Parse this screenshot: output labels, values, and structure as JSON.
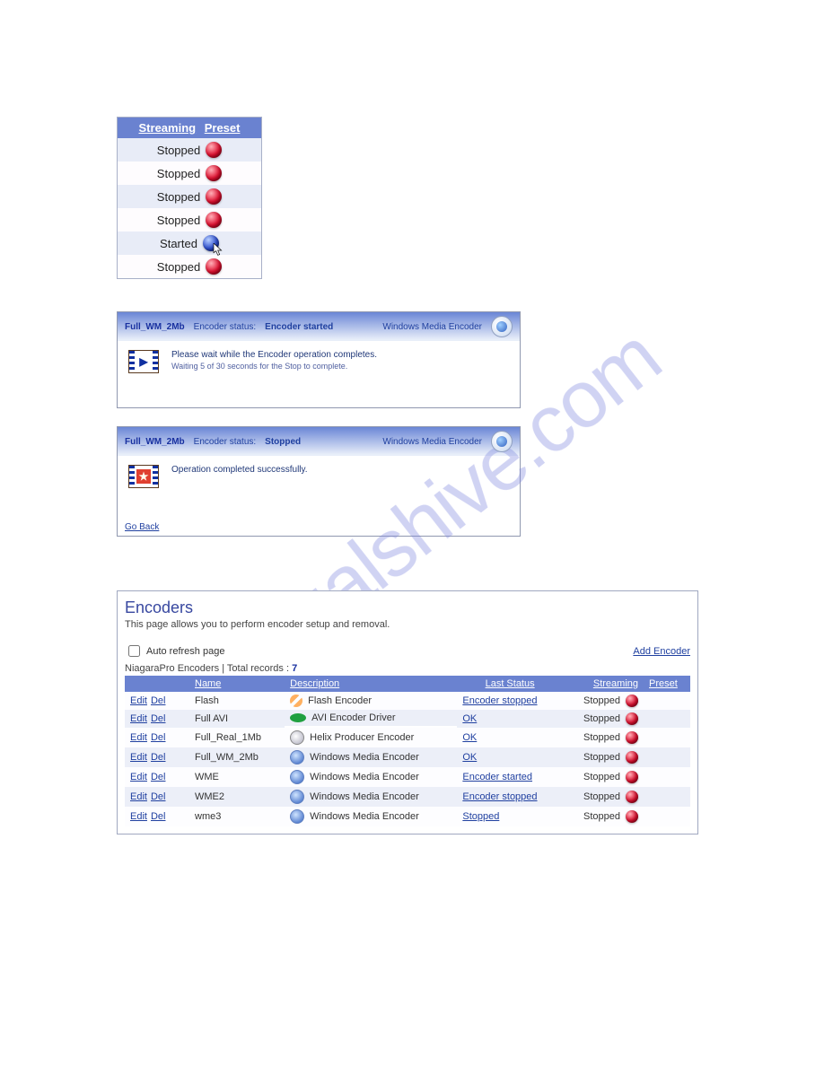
{
  "watermark": "manualshive.com",
  "streaming_header": {
    "col_streaming": "Streaming",
    "col_preset": "Preset"
  },
  "streaming_rows": [
    {
      "label": "Stopped",
      "color": "red"
    },
    {
      "label": "Stopped",
      "color": "red"
    },
    {
      "label": "Stopped",
      "color": "red"
    },
    {
      "label": "Stopped",
      "color": "red"
    },
    {
      "label": "Started",
      "color": "blue",
      "cursor": true
    },
    {
      "label": "Stopped",
      "color": "red"
    }
  ],
  "panel_started": {
    "title": "Full_WM_2Mb",
    "status_label": "Encoder status:",
    "status_value": "Encoder started",
    "encoder_name": "Windows Media Encoder",
    "msg": "Please wait while the Encoder operation completes.",
    "sub": "Waiting 5 of 30 seconds for the Stop to complete."
  },
  "panel_stopped": {
    "title": "Full_WM_2Mb",
    "status_label": "Encoder status:",
    "status_value": "Stopped",
    "encoder_name": "Windows Media Encoder",
    "msg": "Operation completed successfully.",
    "go_back": "Go Back"
  },
  "encoders_page": {
    "heading": "Encoders",
    "subtitle": "This page allows you to perform encoder setup and removal.",
    "auto_refresh": "Auto refresh page",
    "add_link": "Add Encoder",
    "summary_prefix": "NiagaraPro Encoders | Total records : ",
    "summary_count": "7",
    "columns": {
      "actions": "",
      "name": "Name",
      "description": "Description",
      "last_status": "Last Status",
      "streaming": "Streaming",
      "preset": "Preset"
    },
    "action_edit": "Edit",
    "action_del": "Del",
    "rows": [
      {
        "name": "Flash",
        "desc": "Flash Encoder",
        "icon": "flash",
        "status": "Encoder stopped",
        "streaming": "Stopped"
      },
      {
        "name": "Full AVI",
        "desc": "AVI Encoder Driver",
        "icon": "avi",
        "status": "OK",
        "streaming": "Stopped"
      },
      {
        "name": "Full_Real_1Mb",
        "desc": "Helix Producer Encoder",
        "icon": "helix",
        "status": "OK",
        "streaming": "Stopped"
      },
      {
        "name": "Full_WM_2Mb",
        "desc": "Windows Media Encoder",
        "icon": "wme",
        "status": "OK",
        "streaming": "Stopped"
      },
      {
        "name": "WME",
        "desc": "Windows Media Encoder",
        "icon": "wme",
        "status": "Encoder started",
        "streaming": "Stopped"
      },
      {
        "name": "WME2",
        "desc": "Windows Media Encoder",
        "icon": "wme",
        "status": "Encoder stopped",
        "streaming": "Stopped"
      },
      {
        "name": "wme3",
        "desc": "Windows Media Encoder",
        "icon": "wme",
        "status": "Stopped",
        "streaming": "Stopped"
      }
    ]
  }
}
